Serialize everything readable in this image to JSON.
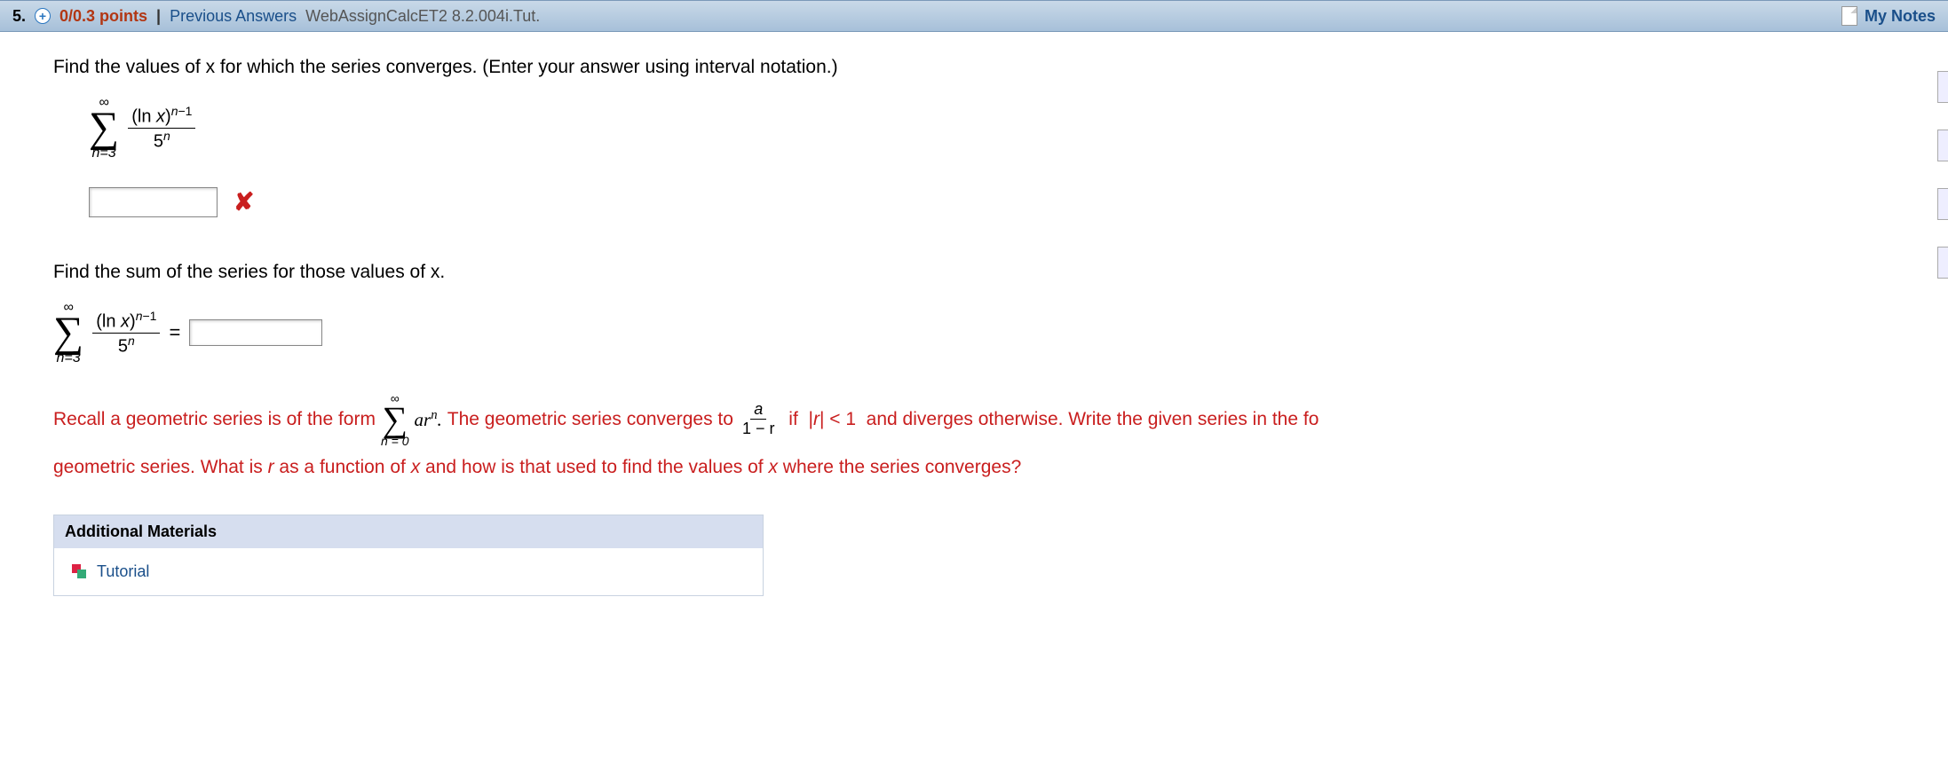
{
  "header": {
    "question_number": "5.",
    "points": "0/0.3 points",
    "separator": "|",
    "previous_answers": "Previous Answers",
    "assignment_code": "WebAssignCalcET2 8.2.004i.Tut.",
    "my_notes": "My Notes"
  },
  "question": {
    "prompt_part1": "Find the values of x for which the series converges. (Enter your answer using interval notation.)",
    "series": {
      "upper": "∞",
      "lower": "n=3",
      "numerator": "(ln x)ⁿ⁻¹",
      "denominator": "5ⁿ"
    },
    "wrong_mark": "✘",
    "prompt_part2": "Find the sum of the series for those values of x.",
    "equals": "=",
    "hint_text": {
      "t1": "Recall a geometric series is of the form",
      "sig_upper": "∞",
      "sig_lower": "n = 0",
      "term": "arⁿ.",
      "t2": "The geometric series converges to",
      "frac_num": "a",
      "frac_den": "1 − r",
      "t3": "if  |r| < 1  and diverges otherwise. Write the given series in the fo",
      "t4": "geometric series. What is r as a function of x and how is that used to find the values of x where the series converges?"
    }
  },
  "materials": {
    "header": "Additional Materials",
    "tutorial": "Tutorial"
  }
}
